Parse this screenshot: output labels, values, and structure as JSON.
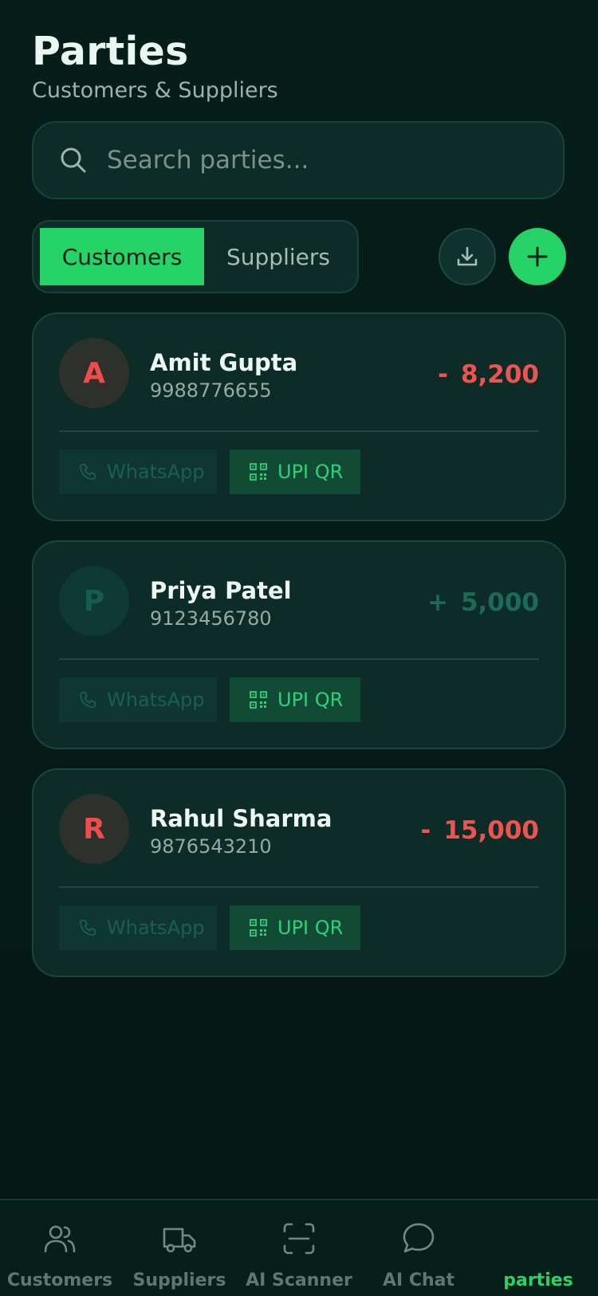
{
  "header": {
    "title": "Parties",
    "subtitle": "Customers & Suppliers"
  },
  "search": {
    "placeholder": "Search parties...",
    "value": "",
    "icon": "search-icon"
  },
  "tabs": [
    {
      "label": "Customers",
      "active": true
    },
    {
      "label": "Suppliers",
      "active": false
    }
  ],
  "actions": {
    "download_icon": "download-icon",
    "add_icon": "plus-icon"
  },
  "colors": {
    "accent": "#25d366",
    "negative": "#ef5350",
    "positive": "#1a6b5d",
    "card_bg": "#0d2c27",
    "page_bg": "#061d19"
  },
  "parties": [
    {
      "initial": "A",
      "name": "Amit Gupta",
      "phone": "9988776655",
      "sign": "-",
      "amount": "8,200",
      "type": "neg"
    },
    {
      "initial": "P",
      "name": "Priya Patel",
      "phone": "9123456780",
      "sign": "+",
      "amount": "5,000",
      "type": "pos"
    },
    {
      "initial": "R",
      "name": "Rahul Sharma",
      "phone": "9876543210",
      "sign": "-",
      "amount": "15,000",
      "type": "neg"
    }
  ],
  "card_buttons": {
    "whatsapp": "WhatsApp",
    "upi": "UPI QR"
  },
  "nav": [
    {
      "label": "Customers",
      "icon": "users-icon",
      "active": false
    },
    {
      "label": "Suppliers",
      "icon": "truck-icon",
      "active": false
    },
    {
      "label": "AI Scanner",
      "icon": "scan-icon",
      "active": false
    },
    {
      "label": "AI Chat",
      "icon": "chat-icon",
      "active": false
    },
    {
      "label": "parties",
      "icon": "",
      "active": true
    }
  ]
}
